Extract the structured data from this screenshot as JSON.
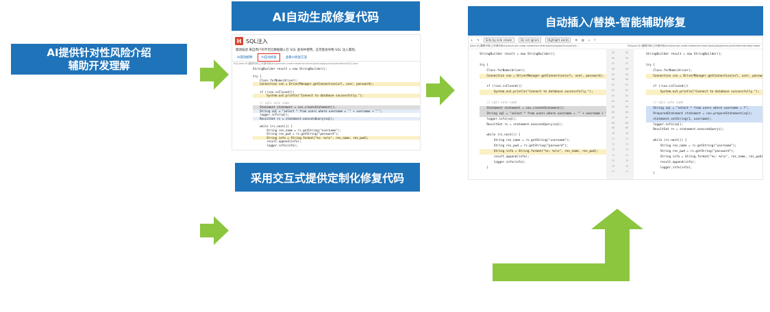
{
  "banners": {
    "ai_risk_line1": "AI提供针对性风险介绍",
    "ai_risk_line2": "辅助开发理解",
    "ai_auto_generate": "AI自动生成修复代码",
    "interactive_fix": "采用交互式提供定制化修复代码",
    "auto_insert": "自动插入/替换-智能辅助修复"
  },
  "colors": {
    "banner_blue": "#1f73b9",
    "arrow_green": "#8cc63f",
    "highlight_red": "#e0241a"
  },
  "screenshot_left": {
    "logo": "H",
    "title": "SQL注入",
    "description": "漏洞描述 来自用户的不可信数据输入在 SQL 查询中使用。这可能会导致 SQL 注入漏洞。",
    "tabs": [
      "AI漏洞解释",
      "AI自动修复",
      "查看AI修复方案"
    ],
    "path": "SQL:java D:\\漏洞代码\\工作源代码\\src\\java-sec-code-master\\src\\main\\java\\org\\joychou\\controller\\SQLI.java",
    "code": [
      "StringBuilder result = new StringBuilder();",
      "",
      "try {",
      "    Class.forName(driver);",
      "    Connection con = DriverManager.getConnection(url, user, password);",
      "",
      "    if (!con.isClosed())",
      "        System.out.println(\"Connect to database successfully.\");",
      "",
      "    // sqli vuln code",
      "    Statement statement = con.createStatement();",
      "    String sql = \"select * from users where username = '\" + username + \"'\";",
      "    logger.info(sql);",
      "    ResultSet rs = statement.executeQuery(sql);",
      "",
      "    while (rs.next()) {",
      "        String res_name = rs.getString(\"username\");",
      "        String res_pwd = rs.getString(\"password\");",
      "        String info = String.format(\"%s: %s\\n\", res_name, res_pwd);",
      "        result.append(info);",
      "        logger.info(info);"
    ]
  },
  "screenshot_right": {
    "toolbar": [
      "Side-by-side viewer",
      "Do not ignore",
      "Highlight words"
    ],
    "left_path": "/java D:\\漏洞代码\\工作源代码\\src\\java-sec-code-master\\src\\main\\java\\org\\joychou\\contro...",
    "right_path": "SQLjava D:\\漏洞代码\\工作源代码\\src\\java-sec-code-master\\src\\main\\java\\org\\joychou\\controller\\window-repair",
    "left_code": [
      "StringBuilder result = new StringBuilder();",
      "",
      "try {",
      "    Class.forName(driver);",
      "    Connection con = DriverManager.getConnection(url, user, password);",
      "",
      "    if (!con.isClosed())",
      "        System.out.println(\"Connect to database successfully.\");",
      "",
      "    // sqli vuln code",
      "    Statement statement = con.createStatement();",
      "    String sql = \"select * from users where username = '\" + username + \"'\";",
      "    logger.info(sql);",
      "    ResultSet rs = statement.executeQuery(sql);",
      "",
      "    while (rs.next()) {",
      "        String res_name = rs.getString(\"username\");",
      "        String res_pwd = rs.getString(\"password\");",
      "        String info = String.format(\"%s: %s\\n\", res_name, res_pwd);",
      "        result.append(info);",
      "        logger.info(info);",
      "    }"
    ],
    "right_code": [
      "StringBuilder result = new StringBuilder();",
      "",
      "try {",
      "    Class.forName(driver);",
      "    Connection con = DriverManager.getConnection(url, user, password",
      "",
      "    if (!con.isClosed())",
      "        System.out.println(\"Connect to database successfully.\");",
      "",
      "    // sqli vuln code",
      "    String sql = \"select * from users where username = ?\";",
      "    PreparedStatement statement = con.prepareStatement(sql);",
      "    statement.setString(1, username);",
      "    logger.info(sql);",
      "    ResultSet rs = statement.executeQuery();",
      "",
      "    while (rs.next()) {",
      "        String res_name = rs.getString(\"username\");",
      "        String res_pwd = rs.getString(\"password\");",
      "        String info = String.format(\"%s: %s\\n\", res_name, res_pwd);",
      "        result.append(info);",
      "        logger.info(info);",
      "    }"
    ],
    "line_numbers": [
      "55",
      "56",
      "57",
      "58",
      "59",
      "60",
      "61",
      "62",
      "63",
      "64",
      "65",
      "66",
      "67",
      "68",
      "69",
      "70",
      "71",
      "72",
      "73",
      "74",
      "75",
      "76",
      "77"
    ]
  }
}
